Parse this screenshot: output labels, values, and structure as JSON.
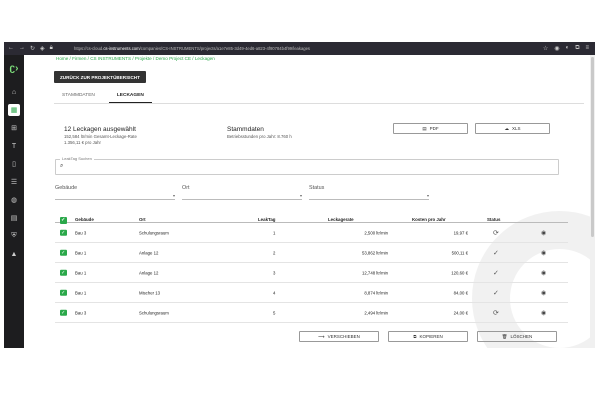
{
  "browser": {
    "url_prefix": "https://cs-cloud.",
    "url_domain": "cs-instruments.com",
    "url_rest": "/companies/CS-INSTRUMENTS/projects/a1e7e85-3d49-4ed6-a823-4f90784b4f99/leakages"
  },
  "breadcrumb": "Home / Firmen / CS INSTRUMENTS / Projekte / Demo Project CE / Leckagen",
  "back_button": "ZURÜCK ZUR PROJEKTÜBERSICHT",
  "tabs": [
    "STAMMDATEN",
    "LECKAGEN"
  ],
  "summary": {
    "title": "12 Leckagen ausgewählt",
    "line1": "152,584 ltr/min Gesamt-Leckage-Rate",
    "line2": "1.356,11 € pro Jahr"
  },
  "stammdaten": {
    "title": "Stammdaten",
    "line1": "Betriebsstunden pro Jahr: 8.760 h"
  },
  "export": {
    "pdf": "PDF",
    "xls": "XLS"
  },
  "search": {
    "label": "LeakTag Suchen"
  },
  "filters": {
    "gebaeude": "Gebäude",
    "ort": "Ort",
    "status": "Status"
  },
  "table": {
    "headers": {
      "gebaeude": "Gebäude",
      "ort": "Ort",
      "leaktag": "LeakTag",
      "rate": "Leckagerate",
      "kosten": "Kosten pro Jahr",
      "status": "Status"
    },
    "rows": [
      {
        "gebaeude": "Bau 3",
        "ort": "Schulungsraum",
        "leaktag": "1",
        "rate": "2,500 ltr/min",
        "kosten": "19,97 €",
        "status": "sync"
      },
      {
        "gebaeude": "Bau 1",
        "ort": "Anlage 12",
        "leaktag": "2",
        "rate": "53,862 ltr/min",
        "kosten": "500,11 €",
        "status": "done"
      },
      {
        "gebaeude": "Bau 1",
        "ort": "Anlage 12",
        "leaktag": "3",
        "rate": "12,748 ltr/min",
        "kosten": "120,60 €",
        "status": "done"
      },
      {
        "gebaeude": "Bau 1",
        "ort": "Mischer 13",
        "leaktag": "4",
        "rate": "8,874 ltr/min",
        "kosten": "84,00 €",
        "status": "done"
      },
      {
        "gebaeude": "Bau 3",
        "ort": "Schulungsraum",
        "leaktag": "5",
        "rate": "2,494 ltr/min",
        "kosten": "24,00 €",
        "status": "sync"
      }
    ]
  },
  "actions": {
    "verschieben": "VERSCHIEBEN",
    "kopieren": "KOPIEREN",
    "loeschen": "LÖSCHEN"
  },
  "colors": {
    "accent": "#2aa84a",
    "sidebar": "#1d1d1f",
    "browser": "#2b2a33"
  }
}
